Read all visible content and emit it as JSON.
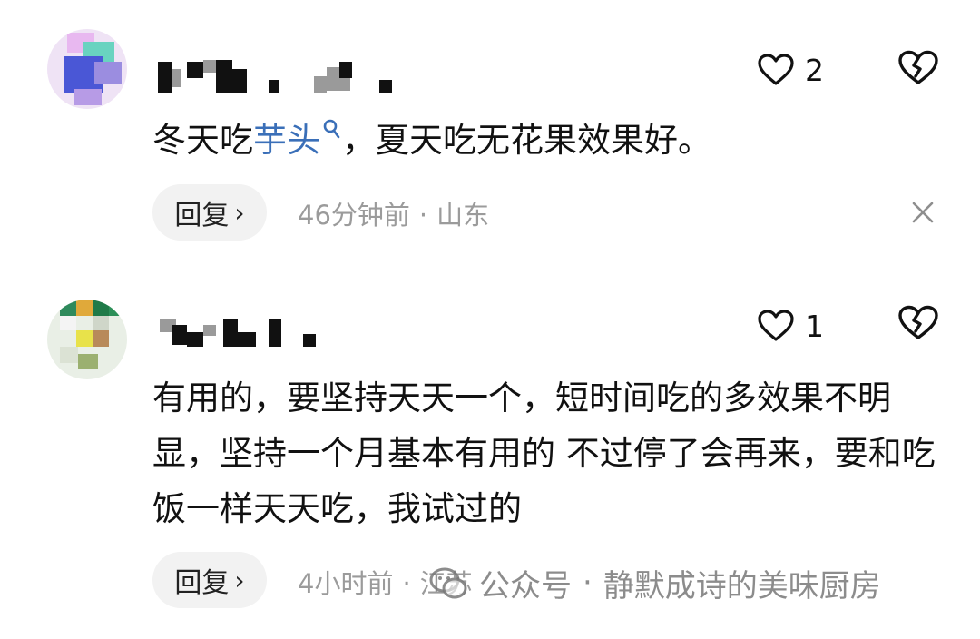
{
  "comments": [
    {
      "likes": "2",
      "text_before": "冬天吃",
      "link_text": "芋头",
      "text_after": "，夏天吃无花果效果好。",
      "reply_label": "回复",
      "time": "46分钟前",
      "location": "山东",
      "avatar_icon": "blurred-avatar",
      "username_icon": "pixelated-username"
    },
    {
      "likes": "1",
      "text": "有用的，要坚持天天一个，短时间吃的多效果不明显，坚持一个月基本有用的 不过停了会再来，要和吃饭一样天天吃，我试过的",
      "reply_label": "回复",
      "time": "4小时前",
      "location": "江苏",
      "avatar_icon": "blurred-avatar",
      "username_icon": "pixelated-username"
    }
  ],
  "watermark": {
    "source": "公众号",
    "name": "静默成诗的美味厨房"
  },
  "icons": {
    "like": "heart-outline-icon",
    "dislike": "broken-heart-icon",
    "close": "close-x-icon",
    "search": "search-icon",
    "chevron": "chevron-right-icon"
  },
  "colors": {
    "link": "#3a6fb8",
    "meta": "#9b9b9b",
    "reply_bg": "#f2f2f2"
  }
}
